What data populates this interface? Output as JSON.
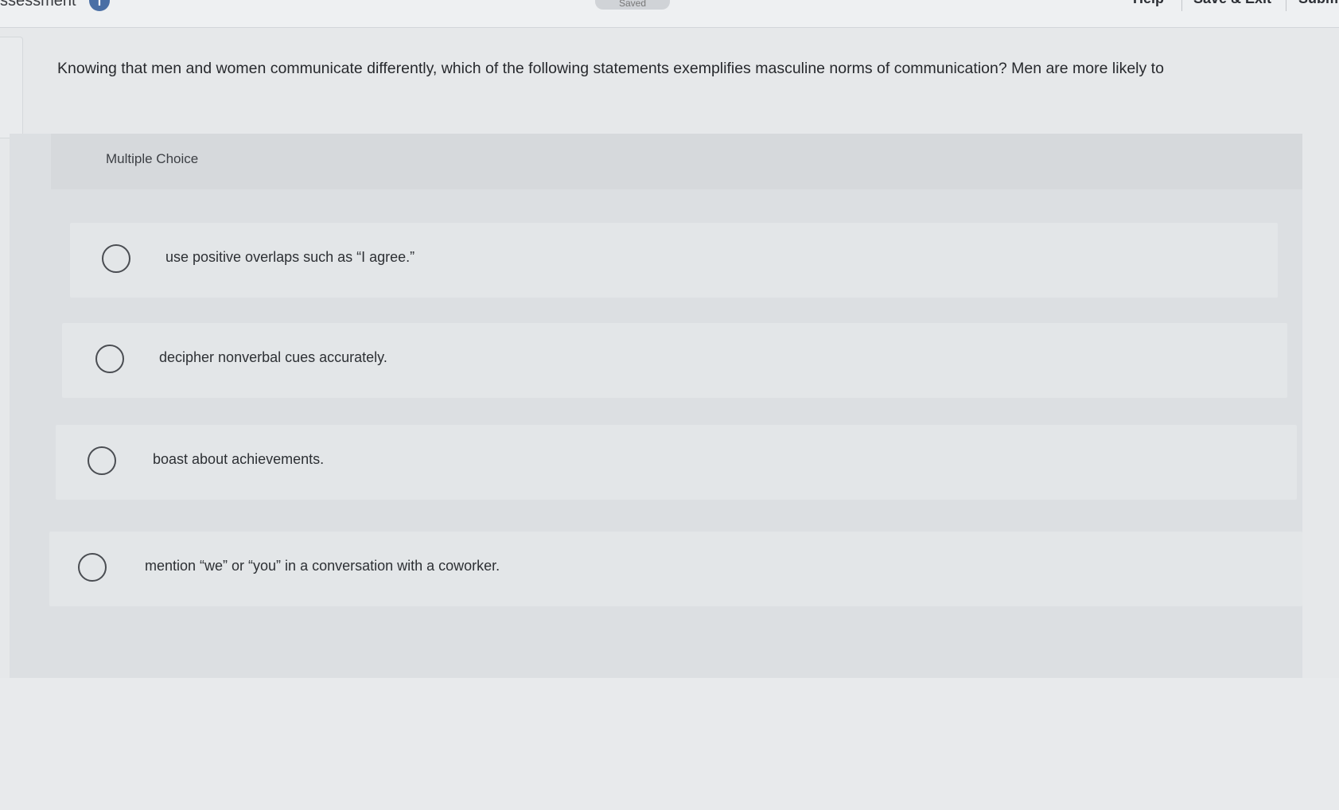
{
  "header": {
    "title": "ssessment",
    "info_icon": "info-icon",
    "saved_label": "Saved",
    "help_label": "Help",
    "save_exit_label": "Save & Exit",
    "submit_label": "Submi"
  },
  "question": {
    "text": "Knowing that men and women communicate differently, which of the following statements exemplifies masculine norms of communication? Men are more likely to"
  },
  "multiple_choice": {
    "label": "Multiple Choice",
    "options": [
      {
        "label": "use positive overlaps such as “I agree.”",
        "selected": false
      },
      {
        "label": "decipher nonverbal cues accurately.",
        "selected": false
      },
      {
        "label": "boast about achievements.",
        "selected": false
      },
      {
        "label": "mention “we” or “you” in a conversation with a coworker.",
        "selected": false
      }
    ]
  }
}
